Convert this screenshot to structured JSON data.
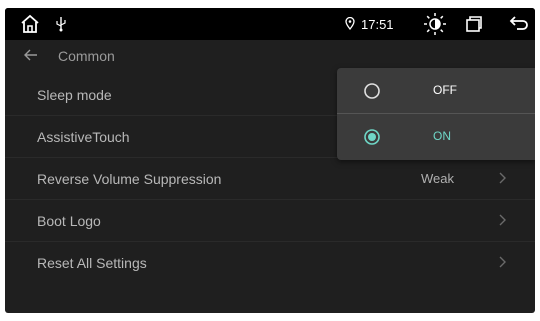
{
  "status_bar": {
    "time": "17:51",
    "icons": [
      "home-icon",
      "usb-icon",
      "location-icon",
      "brightness-icon",
      "recent-apps-icon",
      "back-icon"
    ]
  },
  "header": {
    "title": "Common"
  },
  "settings": [
    {
      "label": "Sleep mode",
      "value": "",
      "chevron": false
    },
    {
      "label": "AssistiveTouch",
      "value": "",
      "chevron": false
    },
    {
      "label": "Reverse Volume Suppression",
      "value": "Weak",
      "chevron": true
    },
    {
      "label": "Boot Logo",
      "value": "",
      "chevron": true
    },
    {
      "label": "Reset All Settings",
      "value": "",
      "chevron": true
    }
  ],
  "popup": {
    "options": [
      {
        "label": "OFF",
        "selected": false
      },
      {
        "label": "ON",
        "selected": true
      }
    ]
  },
  "colors": {
    "accent": "#6fd7c7",
    "background": "#1f1f1f",
    "status_bar": "#000000",
    "popup": "#3b3b3b"
  }
}
